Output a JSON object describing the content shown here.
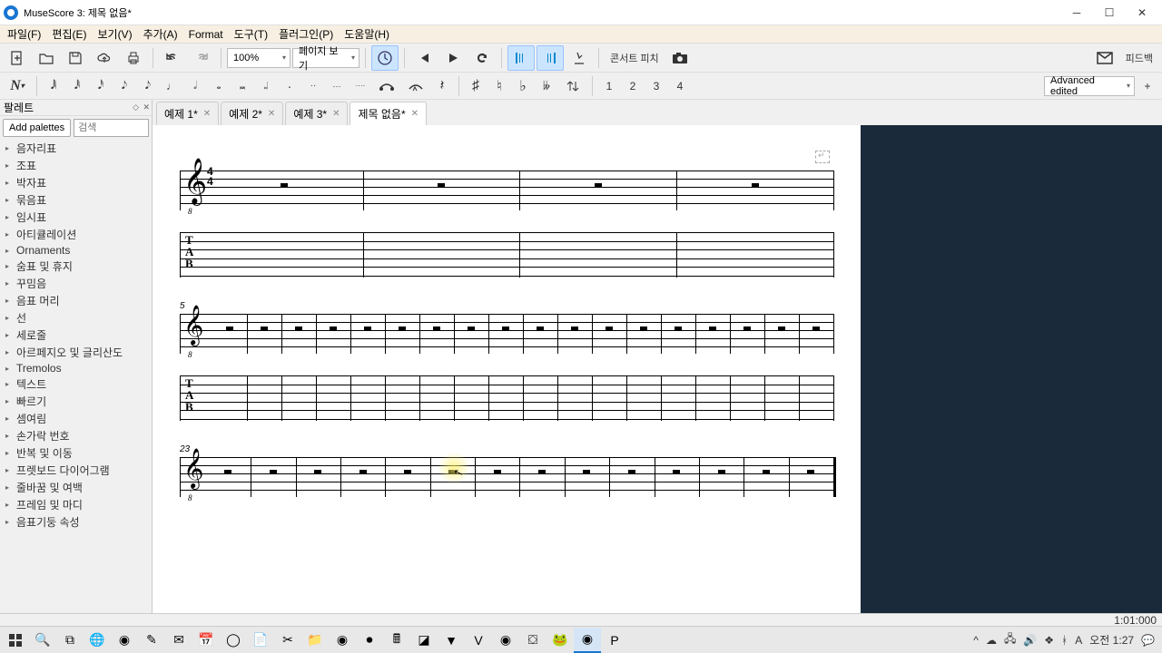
{
  "window": {
    "title": "MuseScore 3: 제목 없음*"
  },
  "menu": {
    "items": [
      "파일(F)",
      "편집(E)",
      "보기(V)",
      "추가(A)",
      "Format",
      "도구(T)",
      "플러그인(P)",
      "도움말(H)"
    ]
  },
  "toolbar1": {
    "zoom": "100%",
    "view_mode": "페이지 보기",
    "concert_pitch": "콘서트 피치",
    "feedback": "피드백"
  },
  "toolbar2": {
    "voices": [
      "1",
      "2",
      "3",
      "4"
    ],
    "workspace": "Advanced edited"
  },
  "palette": {
    "title": "팔레트",
    "add_btn": "Add palettes",
    "search_placeholder": "검색",
    "items": [
      "음자리표",
      "조표",
      "박자표",
      "묶음표",
      "임시표",
      "아티큘레이션",
      "Ornaments",
      "숨표 및 휴지",
      "꾸밈음",
      "음표 머리",
      "선",
      "세로줄",
      "아르페지오 및 글리산도",
      "Tremolos",
      "텍스트",
      "빠르기",
      "셈여림",
      "손가락 번호",
      "반복 및 이동",
      "프렛보드 다이어그램",
      "줄바꿈 및 여백",
      "프레임 및 마디",
      "음표기둥 속성"
    ]
  },
  "tabs": [
    {
      "label": "예제 1*",
      "active": false
    },
    {
      "label": "예제 2*",
      "active": false
    },
    {
      "label": "예제 3*",
      "active": false
    },
    {
      "label": "제목 없음*",
      "active": true
    }
  ],
  "score": {
    "measure_numbers": [
      "5",
      "23"
    ],
    "timesig_top": "4",
    "timesig_bot": "4",
    "tab_letters": "T\nA\nB"
  },
  "status": {
    "position": "1:01:000"
  },
  "taskbar": {
    "time": "오전 1:27",
    "date": ""
  }
}
